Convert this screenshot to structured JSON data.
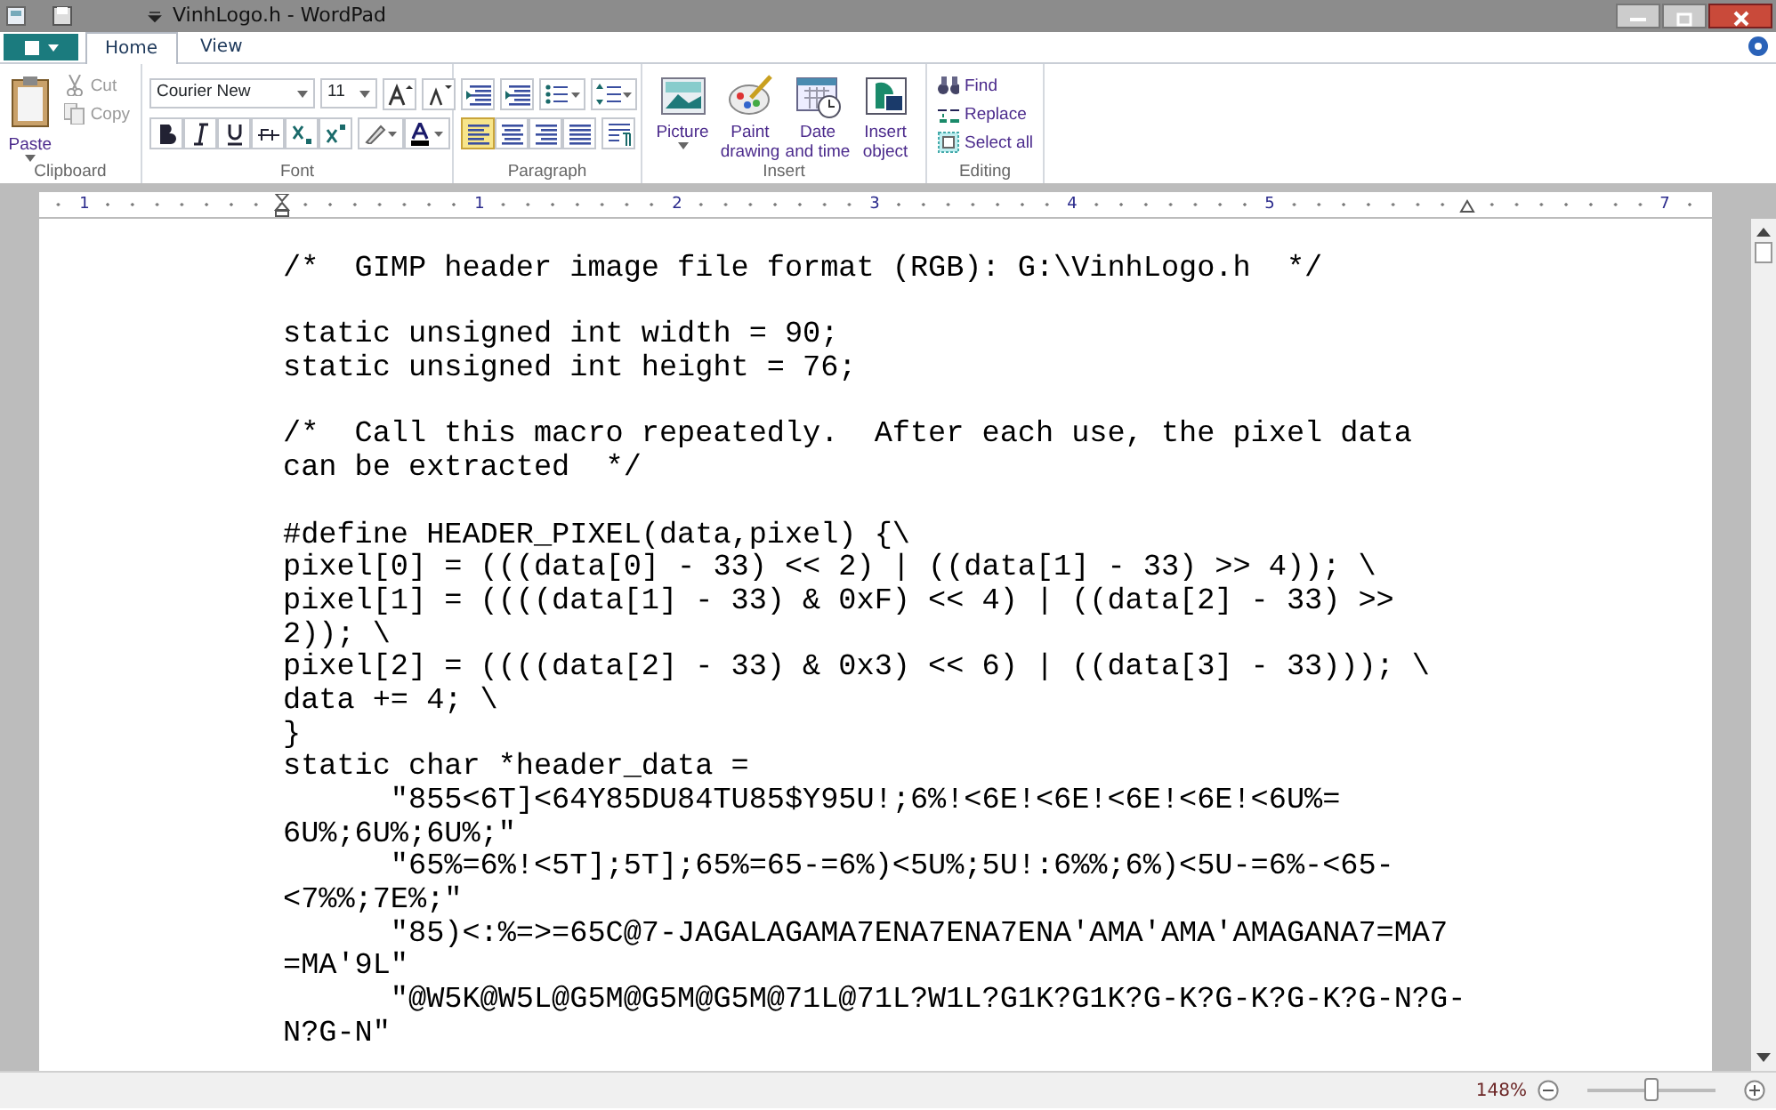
{
  "window": {
    "title": "VinhLogo.h - WordPad"
  },
  "tabs": [
    {
      "label": "Home",
      "selected": true
    },
    {
      "label": "View",
      "selected": false
    }
  ],
  "ribbon": {
    "groups": [
      {
        "label": "Clipboard",
        "kind": "clipboard",
        "paste": "Paste",
        "items": [
          {
            "label": "Cut",
            "disabled": true
          },
          {
            "label": "Copy",
            "disabled": true
          }
        ]
      },
      {
        "label": "Font",
        "kind": "font",
        "font_name": "Courier New",
        "font_size": "11"
      },
      {
        "label": "Paragraph",
        "kind": "paragraph"
      },
      {
        "label": "Insert",
        "kind": "insert",
        "items": [
          {
            "label": "Picture",
            "dropdown": true
          },
          {
            "label": "Paint drawing",
            "dropdown": false
          },
          {
            "label": "Date and time",
            "dropdown": false
          },
          {
            "label": "Insert object",
            "dropdown": false
          }
        ]
      },
      {
        "label": "Editing",
        "kind": "editing",
        "items": [
          {
            "label": "Find"
          },
          {
            "label": "Replace"
          },
          {
            "label": "Select all"
          }
        ]
      }
    ]
  },
  "ruler": [
    {
      "kind": "number",
      "label": "1"
    },
    {
      "kind": "marker"
    },
    {
      "kind": "number",
      "label": "1"
    },
    {
      "kind": "number",
      "label": "2"
    },
    {
      "kind": "number",
      "label": "3"
    },
    {
      "kind": "number",
      "label": "4"
    },
    {
      "kind": "number",
      "label": "5"
    },
    {
      "kind": "marker"
    },
    {
      "kind": "number",
      "label": "7"
    }
  ],
  "document": {
    "lines": [
      "/*  GIMP header image file format (RGB): G:\\VinhLogo.h  */",
      {
        "text": "static unsigned int width = 90;",
        "blank_before": true
      },
      "static unsigned int height = 76;",
      {
        "text": "/*  Call this macro repeatedly.  After each use, the pixel data",
        "blank_before": true
      },
      "can be extracted  */",
      {
        "text": "#define HEADER_PIXEL(data,pixel) {\\",
        "blank_before": true
      },
      "pixel[0] = (((data[0] - 33) << 2) | ((data[1] - 33) >> 4)); \\",
      "pixel[1] = ((((data[1] - 33) & 0xF) << 4) | ((data[2] - 33) >>",
      "2)); \\",
      "pixel[2] = ((((data[2] - 33) & 0x3) << 6) | ((data[3] - 33))); \\",
      "data += 4; \\",
      "}",
      "static char *header_data =",
      "      \"855<6T]<64Y85DU84TU85$Y95U!;6%!<6E!<6E!<6E!<6E!<6U%=",
      "6U%;6U%;6U%;\"",
      "      \"65%=6%!<5T];5T];65%=65-=6%)<5U%;5U!:6%%;6%)<5U-=6%-<65-",
      "<7%%;7E%;\"",
      "      \"85)<:%=>=65C@7-JAGALAGAMA7ENA7ENA7ENA'AMA'AMA'AMAGANA7=MA7",
      "=MA'9L\"",
      "      \"@W5K@W5L@G5M@G5M@G5M@71L@71L?W1L?G1K?G1K?G-K?G-K?G-K?G-N?G-",
      "N?G-N\""
    ]
  },
  "status_bar": {
    "zoom": "148%",
    "level": 0.5
  }
}
